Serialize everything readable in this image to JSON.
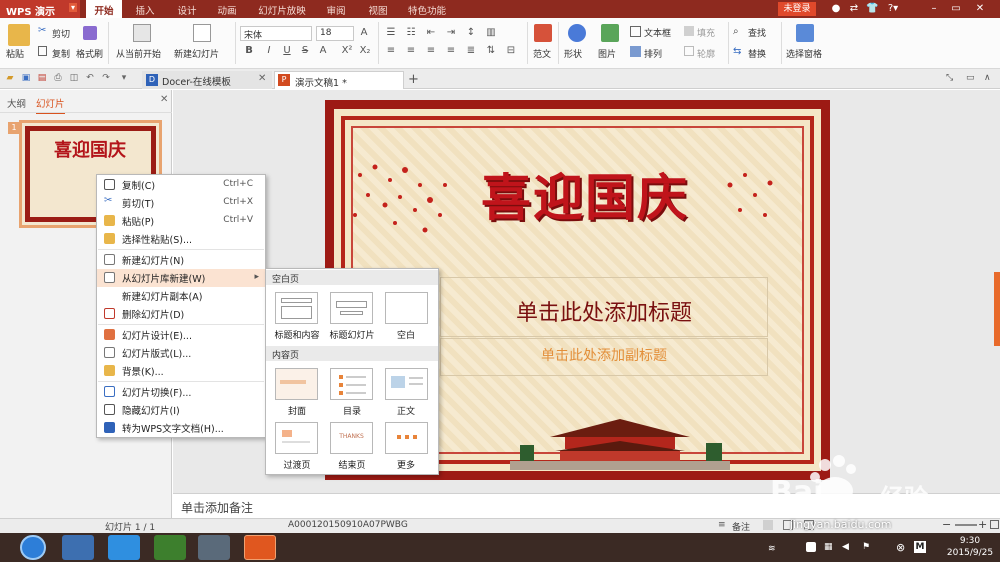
{
  "app": {
    "name": "WPS 演示",
    "login": "未登录"
  },
  "menu_tabs": [
    "开始",
    "插入",
    "设计",
    "动画",
    "幻灯片放映",
    "审阅",
    "视图",
    "特色功能"
  ],
  "ribbon": {
    "paste": "粘贴",
    "cut": "剪切",
    "copy": "复制",
    "format_painter": "格式刷",
    "from_current": "从当前开始",
    "new_slide": "新建幻灯片",
    "font_name": "宋体",
    "font_size": "18",
    "fan_wen": "范文",
    "shape": "形状",
    "picture": "图片",
    "text_box": "文本框",
    "fill": "填充",
    "arrange": "排列",
    "outline": "轮廓",
    "find": "查找",
    "replace": "替换",
    "selection_pane": "选择窗格"
  },
  "doc_tabs": [
    {
      "label": "Docer-在线模板"
    },
    {
      "label": "演示文稿1 *"
    }
  ],
  "left_panel": {
    "tab_outline": "大纲",
    "tab_slides": "幻灯片",
    "thumb_num": "1",
    "thumb_title": "喜迎国庆"
  },
  "slide": {
    "big_title": "喜迎国庆",
    "title_placeholder": "单击此处添加标题",
    "subtitle_placeholder": "单击此处添加副标题"
  },
  "notes_placeholder": "单击添加备注",
  "context_menu": [
    {
      "label": "复制(C)",
      "shortcut": "Ctrl+C"
    },
    {
      "label": "剪切(T)",
      "shortcut": "Ctrl+X"
    },
    {
      "label": "粘贴(P)",
      "shortcut": "Ctrl+V"
    },
    {
      "label": "选择性粘贴(S)...",
      "shortcut": ""
    },
    {
      "label": "新建幻灯片(N)",
      "shortcut": ""
    },
    {
      "label": "从幻灯片库新建(W)",
      "shortcut": ""
    },
    {
      "label": "新建幻灯片副本(A)",
      "shortcut": ""
    },
    {
      "label": "删除幻灯片(D)",
      "shortcut": ""
    },
    {
      "label": "幻灯片设计(E)...",
      "shortcut": ""
    },
    {
      "label": "幻灯片版式(L)...",
      "shortcut": ""
    },
    {
      "label": "背景(K)...",
      "shortcut": ""
    },
    {
      "label": "幻灯片切换(F)...",
      "shortcut": ""
    },
    {
      "label": "隐藏幻灯片(I)",
      "shortcut": ""
    },
    {
      "label": "转为WPS文字文档(H)...",
      "shortcut": ""
    }
  ],
  "submenu": {
    "section_blank": "空白页",
    "section_content": "内容页",
    "blank_layouts": [
      "标题和内容",
      "标题幻灯片",
      "空白"
    ],
    "content_layouts": [
      "封面",
      "目录",
      "正文",
      "过渡页",
      "结束页",
      "更多"
    ],
    "thanks_text": "THANKS"
  },
  "status": {
    "slide_count": "幻灯片 1 / 1",
    "template": "A000120150910A07PWBG",
    "notes": "备注",
    "zoom_minus": "−",
    "zoom_plus": "+"
  },
  "tray": {
    "time": "9:30",
    "date": "2015/9/25"
  },
  "watermark": {
    "brand": "Bai",
    "brand2": "经验",
    "url": "jingyan.baidu.com"
  },
  "colors": {
    "menubar": "#8e2a1f",
    "accent": "#c0392b",
    "slide_frame": "#9d1a14",
    "title_red": "#c0141b",
    "subtitle_orange": "#e38f3a"
  }
}
